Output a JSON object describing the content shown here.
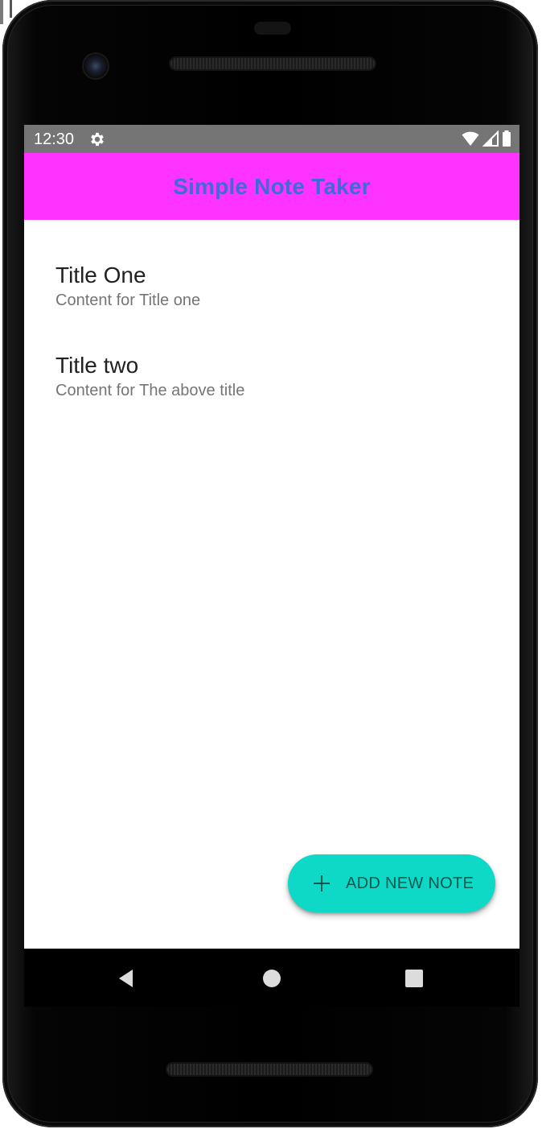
{
  "status_bar": {
    "time": "12:30",
    "icons": [
      "settings-gear-icon",
      "wifi-icon",
      "signal-icon",
      "battery-icon"
    ]
  },
  "app_bar": {
    "title": "Simple Note Taker",
    "background_color": "#ff33ff",
    "title_color": "#3f6bd6"
  },
  "notes": [
    {
      "title": "Title One",
      "content": "Content for Title one"
    },
    {
      "title": "Title two",
      "content": "Content for The above title"
    }
  ],
  "fab": {
    "icon": "plus-icon",
    "label": "ADD NEW NOTE",
    "color": "#0dd9c6"
  },
  "nav_bar": {
    "buttons": [
      "back-icon",
      "home-icon",
      "recents-icon"
    ]
  }
}
